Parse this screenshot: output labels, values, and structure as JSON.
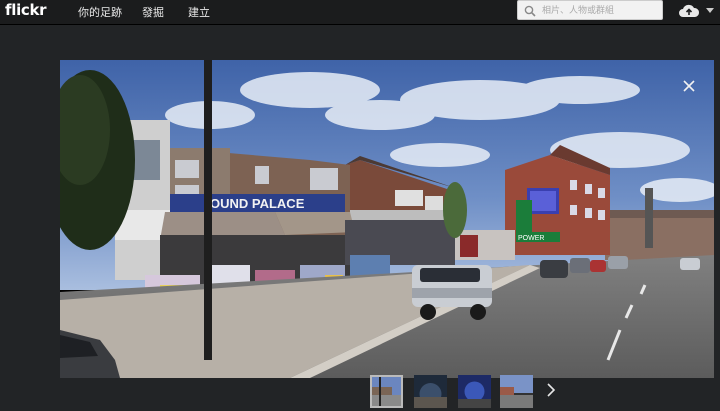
{
  "header": {
    "logo": "flickr",
    "nav": [
      "你的足跡",
      "發掘",
      "建立"
    ],
    "search_placeholder": "相片、人物或群組",
    "upload_icon": "cloud-upload-icon",
    "menu_icon": "caret-down-icon"
  },
  "viewer": {
    "close_icon": "close-icon",
    "next_icon": "chevron-right-icon",
    "thumbnails": [
      {
        "selected": true
      },
      {
        "selected": false
      },
      {
        "selected": false
      },
      {
        "selected": false
      }
    ]
  },
  "street_signs": {
    "shop_sign": "OUND PALACE",
    "pub_sign": "POWER"
  },
  "colors": {
    "topbar": "#1b1c1d",
    "background": "#222426",
    "sky": "#4f6fb0"
  }
}
